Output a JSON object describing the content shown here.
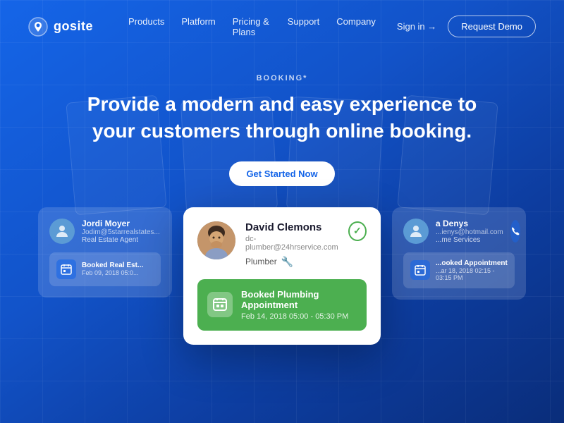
{
  "brand": {
    "name": "gosite"
  },
  "navbar": {
    "links": [
      {
        "label": "Products",
        "id": "products"
      },
      {
        "label": "Platform",
        "id": "platform"
      },
      {
        "label": "Pricing & Plans",
        "id": "pricing"
      },
      {
        "label": "Support",
        "id": "support"
      },
      {
        "label": "Company",
        "id": "company"
      }
    ],
    "sign_in": "Sign in →",
    "request_demo": "Request Demo"
  },
  "hero": {
    "tag": "BOOKING*",
    "title_line1": "Provide a modern and easy experience to",
    "title_line2": "your customers through online booking.",
    "cta": "Get Started Now"
  },
  "side_card_left": {
    "name": "Jordi Moyer",
    "email": "Jodim@5starrealstates...",
    "role": "Real Estate Agent",
    "booking_label": "Booked Real Est...",
    "booking_date": "Feb 09, 2018 05:0..."
  },
  "side_card_right": {
    "name": "a Denys",
    "email": "...ienys@hotmail.com",
    "role": "...me Services",
    "booking_label": "...ooked Appointment",
    "booking_date": "...ar 18, 2018 02:15 - 03:15 PM"
  },
  "main_card": {
    "name": "David Clemons",
    "email": "dc-plumber@24hrservice.com",
    "role": "Plumber",
    "booking_label": "Booked Plumbing Appointment",
    "booking_date": "Feb 14, 2018 05:00 - 05:30 PM",
    "check_icon": "✓"
  },
  "colors": {
    "primary": "#1565e8",
    "green": "#4caf50",
    "white": "#ffffff"
  }
}
